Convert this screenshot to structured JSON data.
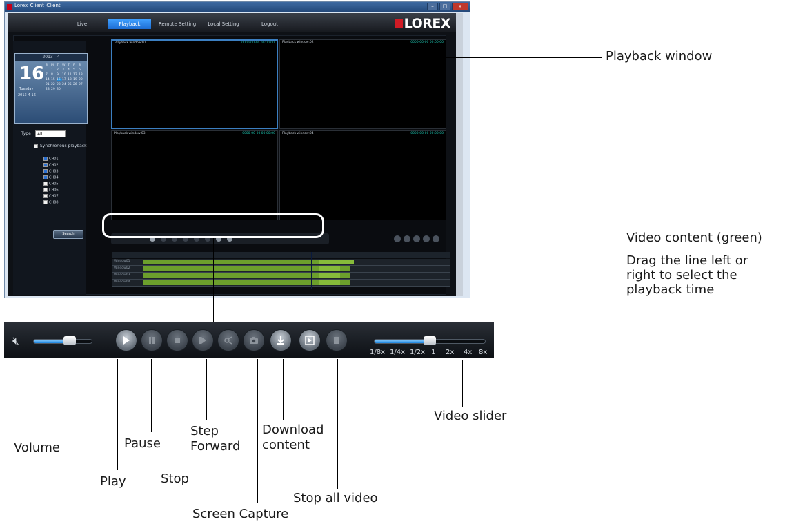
{
  "window": {
    "title": "Lorex_Client_Client",
    "buttons": {
      "minimize": "–",
      "maximize": "□",
      "close": "x"
    }
  },
  "nav": {
    "tabs": [
      "Live",
      "Playback",
      "Remote Setting",
      "Local Setting",
      "Logout"
    ],
    "active_tab": "Playback",
    "brand": "LOREX"
  },
  "calendar": {
    "month": "2013 - 4",
    "day": "16",
    "weekday": "Tuesday",
    "date": "2013-4-16",
    "weekday_headers": [
      "S",
      "M",
      "T",
      "W",
      "T",
      "F",
      "S"
    ],
    "days": [
      "",
      "1",
      "2",
      "3",
      "4",
      "5",
      "6",
      "7",
      "8",
      "9",
      "10",
      "11",
      "12",
      "13",
      "14",
      "15",
      "16",
      "17",
      "18",
      "19",
      "20",
      "21",
      "22",
      "23",
      "24",
      "25",
      "26",
      "27",
      "28",
      "29",
      "30"
    ]
  },
  "filters": {
    "type_label": "Type",
    "type_value": "All",
    "sync_label": "Synchronous playback",
    "channels": [
      "CH01",
      "CH02",
      "CH03",
      "CH04",
      "CH05",
      "CH06",
      "CH07",
      "CH08"
    ],
    "channels_checked": [
      true,
      true,
      true,
      true,
      false,
      false,
      false,
      false
    ],
    "search_label": "Search"
  },
  "playback_windows": [
    {
      "label": "Playback window:01",
      "time": "0000-00-00 00:00:00"
    },
    {
      "label": "Playback window:02",
      "time": "0000-00-00 00:00:00"
    },
    {
      "label": "Playback window:03",
      "time": "0000-00-00 00:00:00"
    },
    {
      "label": "Playback window:04",
      "time": "0000-00-00 00:00:00"
    }
  ],
  "timeline": {
    "rows": [
      "Window01",
      "Window02",
      "Window03",
      "Window04"
    ],
    "content_color": "#6c9f2c"
  },
  "controls": {
    "volume_level": 0.62,
    "speed_labels": [
      "1/8x",
      "1/4x",
      "1/2x",
      "1",
      "2x",
      "4x",
      "8x"
    ],
    "speed_value": "1",
    "buttons": [
      "play",
      "pause",
      "stop",
      "step-forward",
      "capture-disabled",
      "screen-capture",
      "download",
      "stop-all-video",
      "stop-all-disabled"
    ]
  },
  "annotations": {
    "playback_window": "Playback window",
    "video_content": "Video content (green)",
    "drag_line": [
      "Drag the line left or",
      "right to select the",
      "playback time"
    ],
    "volume": "Volume",
    "play": "Play",
    "pause": "Pause",
    "stop": "Stop",
    "step_forward": [
      "Step",
      "Forward"
    ],
    "download": [
      "Download",
      "content"
    ],
    "screen_capture": "Screen Capture",
    "stop_all": "Stop all video",
    "video_slider": "Video slider"
  },
  "colors": {
    "accent_blue": "#1c6cd2",
    "timestamp_cyan": "#1ec8b4",
    "brand_red": "#d01b25",
    "video_green": "#6c9f2c"
  }
}
